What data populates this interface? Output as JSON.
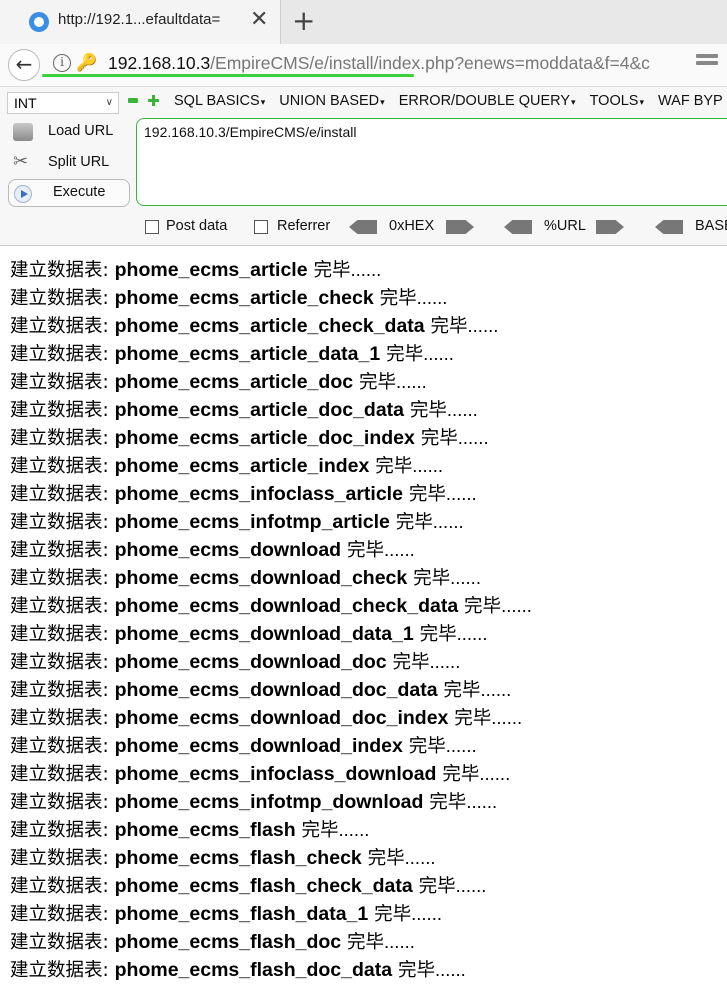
{
  "browser": {
    "tab_title": "http://192.1...efaultdata=",
    "tab_close": "✕",
    "new_tab": "+",
    "url_host": "192.168.10.3",
    "url_path": "/EmpireCMS/e/install/index.php?enews=moddata&f=4&c"
  },
  "hackbar": {
    "type_select": "INT",
    "menus": [
      "SQL BASICS",
      "UNION BASED",
      "ERROR/DOUBLE QUERY",
      "TOOLS",
      "WAF BYP"
    ],
    "load_url": "Load URL",
    "split_url": "Split URL",
    "execute": "Execute",
    "url_value": "192.168.10.3/EmpireCMS/e/install",
    "post_data": "Post data",
    "referrer": "Referrer",
    "hex": "0xHEX",
    "urlenc": "%URL",
    "base": "BASE"
  },
  "content": {
    "prefix": "建立数据表: ",
    "suffix": " 完毕",
    "ellipsis": "......",
    "tables": [
      "phome_ecms_article",
      "phome_ecms_article_check",
      "phome_ecms_article_check_data",
      "phome_ecms_article_data_1",
      "phome_ecms_article_doc",
      "phome_ecms_article_doc_data",
      "phome_ecms_article_doc_index",
      "phome_ecms_article_index",
      "phome_ecms_infoclass_article",
      "phome_ecms_infotmp_article",
      "phome_ecms_download",
      "phome_ecms_download_check",
      "phome_ecms_download_check_data",
      "phome_ecms_download_data_1",
      "phome_ecms_download_doc",
      "phome_ecms_download_doc_data",
      "phome_ecms_download_doc_index",
      "phome_ecms_download_index",
      "phome_ecms_infoclass_download",
      "phome_ecms_infotmp_download",
      "phome_ecms_flash",
      "phome_ecms_flash_check",
      "phome_ecms_flash_check_data",
      "phome_ecms_flash_data_1",
      "phome_ecms_flash_doc",
      "phome_ecms_flash_doc_data"
    ]
  }
}
